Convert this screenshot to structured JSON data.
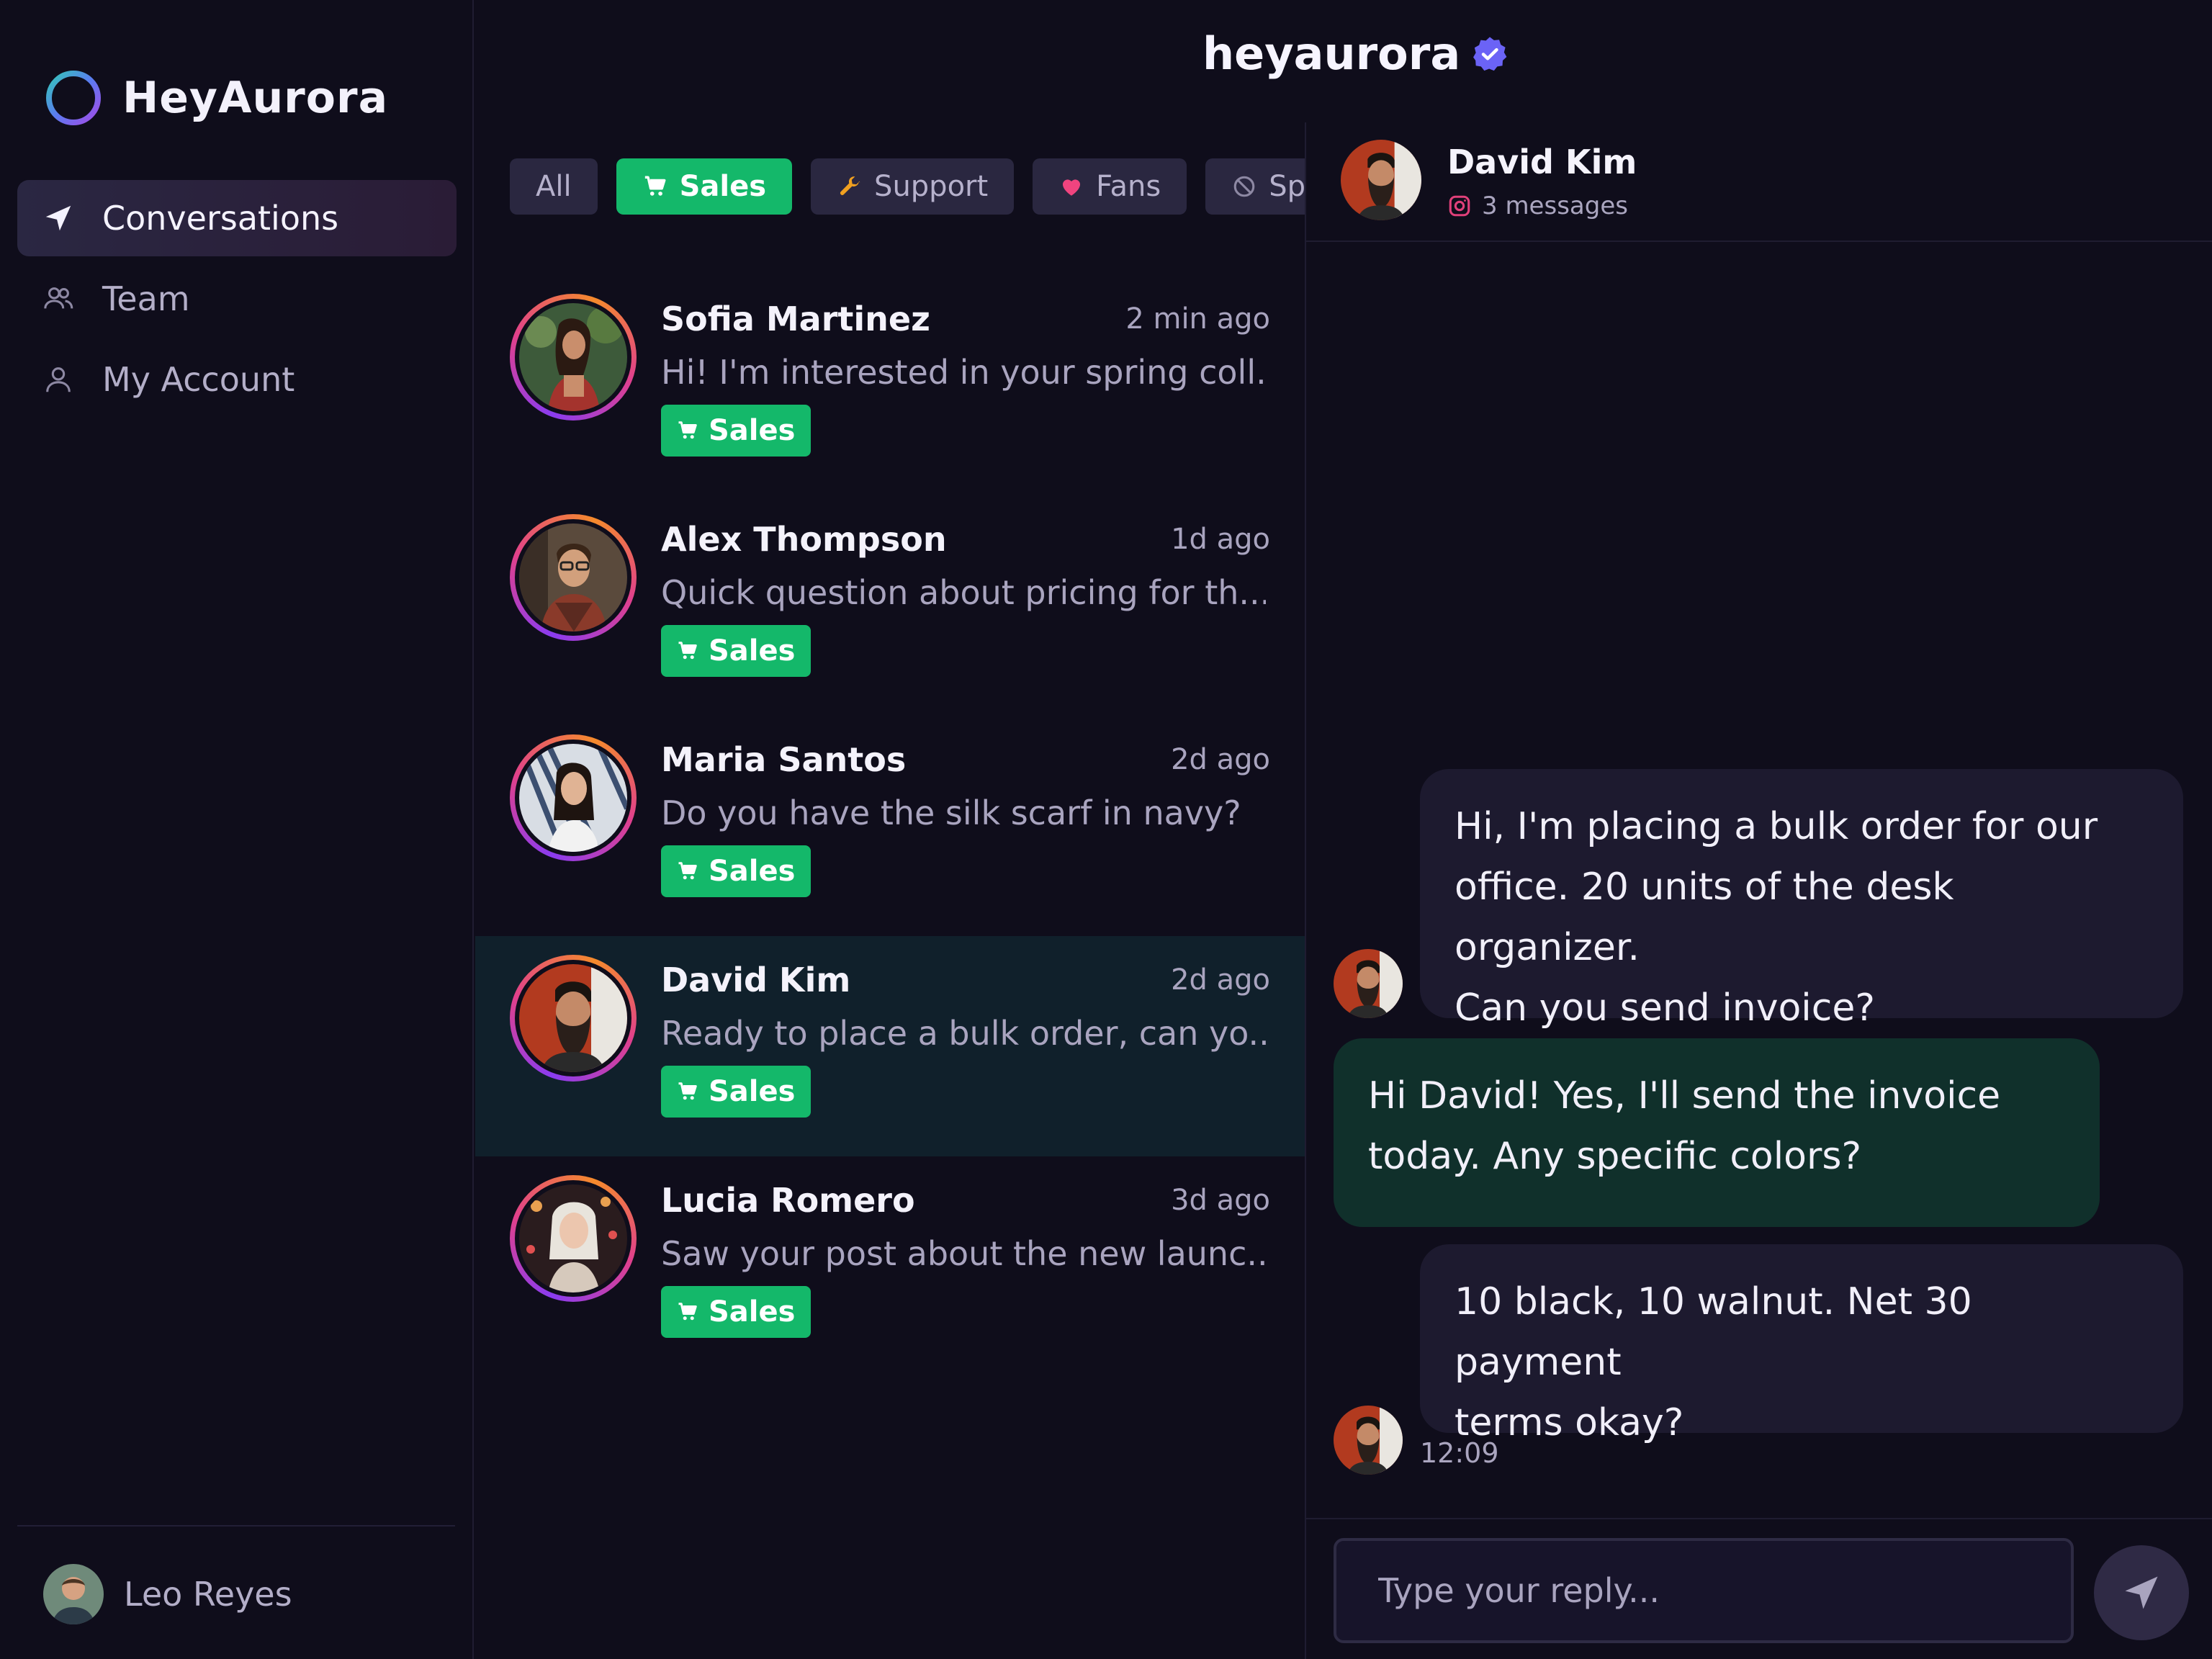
{
  "brand": {
    "name": "HeyAurora"
  },
  "nav": {
    "items": [
      {
        "label": "Conversations",
        "icon": "send-icon",
        "active": true
      },
      {
        "label": "Team",
        "icon": "team-icon",
        "active": false
      },
      {
        "label": "My Account",
        "icon": "user-icon",
        "active": false
      }
    ]
  },
  "user": {
    "name": "Leo Reyes"
  },
  "header": {
    "account": "heyaurora",
    "verified_icon": "verified-badge-icon"
  },
  "filters": [
    {
      "label": "All",
      "icon": ""
    },
    {
      "label": "Sales",
      "icon": "cart-icon"
    },
    {
      "label": "Support",
      "icon": "wrench-icon"
    },
    {
      "label": "Fans",
      "icon": "heart-icon"
    },
    {
      "label": "Spa",
      "icon": "spam-icon"
    }
  ],
  "conversations": [
    {
      "name": "Sofia Martinez",
      "time": "2 min ago",
      "preview": "Hi! I'm interested in your spring coll...",
      "tag": "Sales"
    },
    {
      "name": "Alex Thompson",
      "time": "1d ago",
      "preview": "Quick question about pricing for th...",
      "tag": "Sales"
    },
    {
      "name": "Maria Santos",
      "time": "2d ago",
      "preview": "Do you have the silk scarf in navy?",
      "tag": "Sales"
    },
    {
      "name": "David Kim",
      "time": "2d ago",
      "preview": "Ready to place a bulk order, can yo...",
      "tag": "Sales"
    },
    {
      "name": "Lucia Romero",
      "time": "3d ago",
      "preview": "Saw your post about the new launc...",
      "tag": "Sales"
    }
  ],
  "chat": {
    "name": "David Kim",
    "meta": "3 messages",
    "messages": [
      {
        "line1": "Hi, I'm placing a bulk order for our",
        "line2": "office. 20 units of the desk organizer.",
        "line3": "Can you send invoice?"
      },
      {
        "line1": "Hi David! Yes, I'll send the invoice",
        "line2": "today. Any specific colors?"
      },
      {
        "line1": "10 black, 10 walnut. Net 30 payment",
        "line2": "terms okay?"
      }
    ],
    "time": "12:09",
    "reply_placeholder": "Type your reply..."
  },
  "colors": {
    "accent_green": "#14b86a",
    "background": "#0f0d1b",
    "verified": "#6b63f6"
  }
}
